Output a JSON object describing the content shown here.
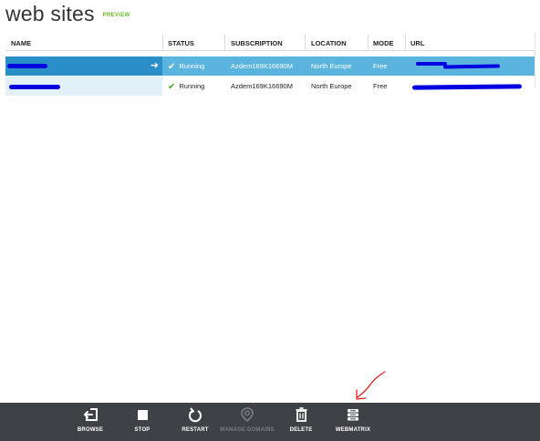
{
  "page": {
    "title": "web sites",
    "badge": "PREVIEW"
  },
  "grid": {
    "columns": [
      "NAME",
      "STATUS",
      "SUBSCRIPTION",
      "LOCATION",
      "MODE",
      "URL"
    ],
    "rows": [
      {
        "name": "",
        "status": "Running",
        "subscription": "Azdem169K16690M",
        "location": "North Europe",
        "mode": "Free",
        "url": "",
        "selected": true
      },
      {
        "name": "",
        "status": "Running",
        "subscription": "Azdem169K16690M",
        "location": "North Europe",
        "mode": "Free",
        "url": "",
        "selected": false
      }
    ]
  },
  "command_bar": {
    "items": [
      {
        "label": "BROWSE",
        "icon": "browse-icon",
        "enabled": true
      },
      {
        "label": "STOP",
        "icon": "stop-icon",
        "enabled": true
      },
      {
        "label": "RESTART",
        "icon": "restart-icon",
        "enabled": true
      },
      {
        "label": "MANAGE DOMAINS",
        "icon": "manage-domains-icon",
        "enabled": false
      },
      {
        "label": "DELETE",
        "icon": "delete-icon",
        "enabled": true
      },
      {
        "label": "WEBMATRIX",
        "icon": "webmatrix-icon",
        "enabled": true
      }
    ]
  },
  "colors": {
    "selected_row": "#5ab4de",
    "selected_name_cell": "#2a8ec8",
    "running_check": "#4caa22",
    "command_bar": "#3e4146",
    "redaction": "#0000e0",
    "annotation_arrow": "#e02020"
  }
}
